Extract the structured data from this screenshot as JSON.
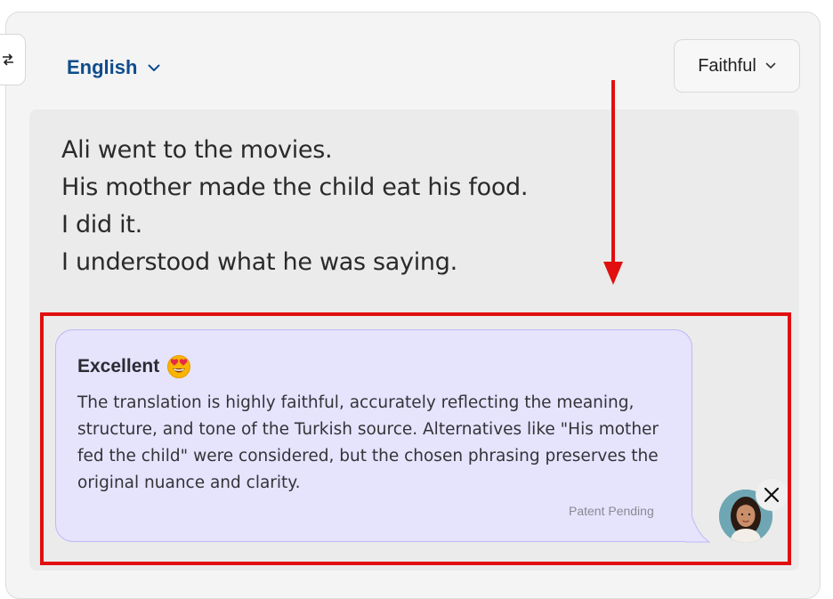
{
  "toolbar": {
    "swap_icon": "swap-arrows-icon",
    "language_label": "English",
    "mode_label": "Faithful",
    "chevron_icon": "chevron-down-icon"
  },
  "translation": {
    "lines": [
      "Ali went to the movies.",
      "His mother made the child eat his food.",
      "I did it.",
      "I understood what he was saying."
    ]
  },
  "feedback": {
    "title": "Excellent",
    "emoji": "heart-eyes-emoji-icon",
    "body": "The translation is highly faithful, accurately reflecting the meaning, structure, and tone of the Turkish source. Alternatives like \"His mother fed the child\" were considered, but the chosen phrasing preserves the original nuance and clarity.",
    "footer": "Patent Pending",
    "close_icon": "close-icon"
  },
  "colors": {
    "accent_blue": "#0f4c8c",
    "highlight_red": "#e10f0f",
    "bubble_bg": "#e6e3fd"
  }
}
